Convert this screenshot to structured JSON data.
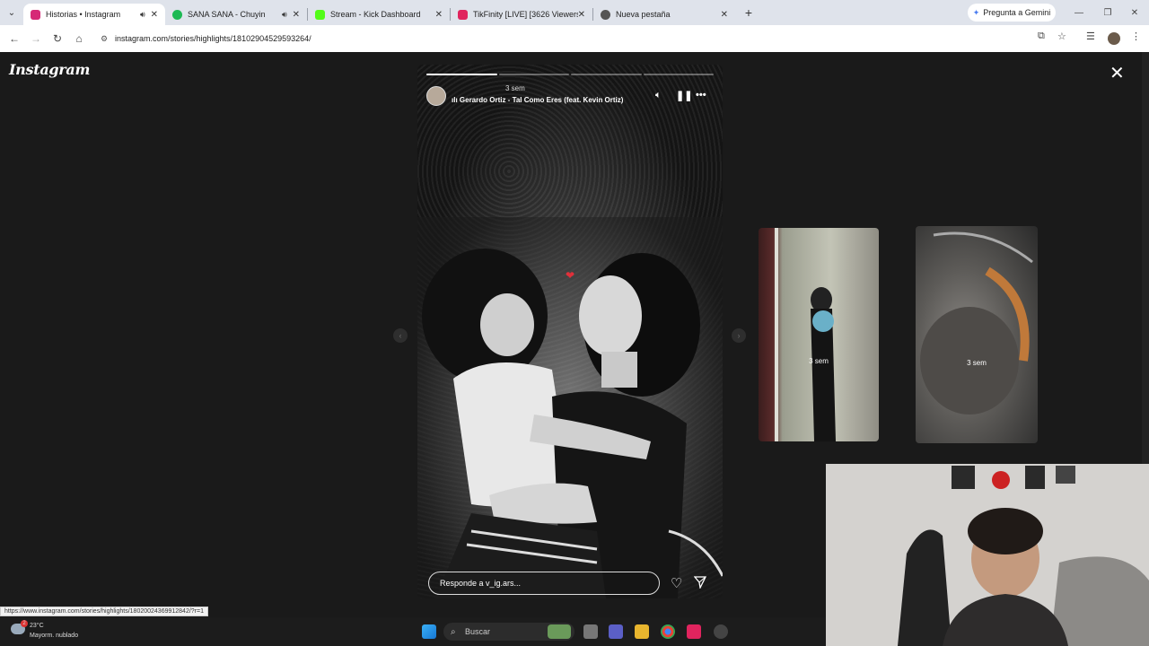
{
  "browser": {
    "tabs": [
      {
        "title": "Historias • Instagram",
        "active": true,
        "audio": true,
        "favicon_color": "#d62976"
      },
      {
        "title": "SANA SANA - Chuyin",
        "active": false,
        "audio": true,
        "favicon_color": "#1db954"
      },
      {
        "title": "Stream - Kick Dashboard",
        "active": false,
        "audio": false,
        "favicon_color": "#53fc18"
      },
      {
        "title": "TikFinity [LIVE] [3626 Viewers]",
        "active": false,
        "audio": false,
        "favicon_color": "#e0245e"
      },
      {
        "title": "Nueva pestaña",
        "active": false,
        "audio": false,
        "favicon_color": "#555555"
      }
    ],
    "gemini_label": "Pregunta a Gemini",
    "url": "instagram.com/stories/highlights/18102904529593264/"
  },
  "page": {
    "logo": "Instagram",
    "story": {
      "time": "3 sem",
      "music": "Gerardo Ortiz - Tal Como Eres (feat. Kevin Ortiz)",
      "segments_total": 4,
      "segments_done": 1,
      "reply_placeholder": "Responde a v_ig.ars..."
    },
    "thumbnails": [
      {
        "label": "3 sem"
      },
      {
        "label": "3 sem"
      }
    ],
    "status_url": "https://www.instagram.com/stories/highlights/18020024369912842/?r=1"
  },
  "taskbar": {
    "temperature": "23°C",
    "weather": "Mayorm. nublado",
    "search_placeholder": "Buscar",
    "weather_badge": "2"
  },
  "colors": {
    "background": "#1a1a1a",
    "accent": "#e0303a"
  }
}
